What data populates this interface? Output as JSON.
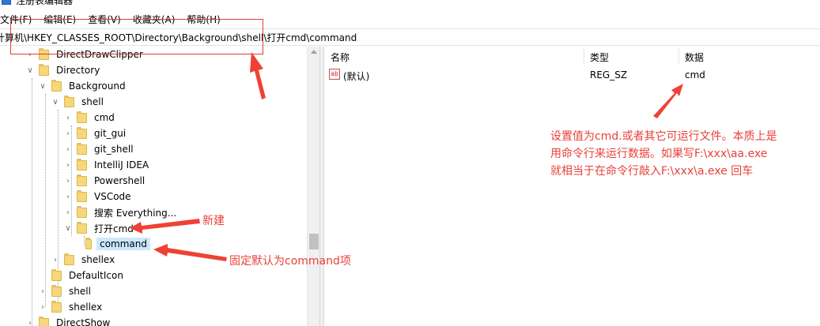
{
  "window": {
    "title": "注册表编辑器"
  },
  "menu": [
    "文件(F)",
    "编辑(E)",
    "查看(V)",
    "收藏夹(A)",
    "帮助(H)"
  ],
  "address": "计算机\\HKEY_CLASSES_ROOT\\Directory\\Background\\shell\\打开cmd\\command",
  "tree": {
    "items": [
      {
        "label": "DirectDrawClipper",
        "expanded": false
      },
      {
        "label": "Directory",
        "expanded": true
      },
      {
        "label": "Background",
        "expanded": true
      },
      {
        "label": "shell",
        "expanded": true
      },
      {
        "label": "cmd",
        "expanded": false
      },
      {
        "label": "git_gui",
        "expanded": false
      },
      {
        "label": "git_shell",
        "expanded": false
      },
      {
        "label": "IntelliJ IDEA",
        "expanded": false
      },
      {
        "label": "Powershell",
        "expanded": false
      },
      {
        "label": "VSCode",
        "expanded": false
      },
      {
        "label": "搜索 Everything...",
        "expanded": false
      },
      {
        "label": "打开cmd",
        "expanded": true
      },
      {
        "label": "command",
        "selected": true
      },
      {
        "label": "shellex",
        "expanded": false
      },
      {
        "label": "DefaultIcon"
      },
      {
        "label": "shell",
        "expanded": false
      },
      {
        "label": "shellex",
        "expanded": false
      },
      {
        "label": "DirectShow",
        "expanded": false
      }
    ]
  },
  "list": {
    "columns": [
      "名称",
      "类型",
      "数据"
    ],
    "rows": [
      {
        "icon": "ab",
        "name": "(默认)",
        "type": "REG_SZ",
        "data": "cmd"
      }
    ]
  },
  "annotations": {
    "new_label": "新建",
    "default_label": "固定默认为command项",
    "note_lines": [
      "设置值为cmd.或者其它可运行文件。本质上是",
      "用命令行来运行数据。如果写F:\\xxx\\aa.exe",
      "就相当于在命令行敲入F:\\xxx\\a.exe 回车"
    ],
    "color": "#e8403a"
  },
  "icons": {
    "collapsed": "chevron-right-icon",
    "expanded": "chevron-down-icon",
    "folder": "folder-icon",
    "value": "ab-string-icon"
  }
}
